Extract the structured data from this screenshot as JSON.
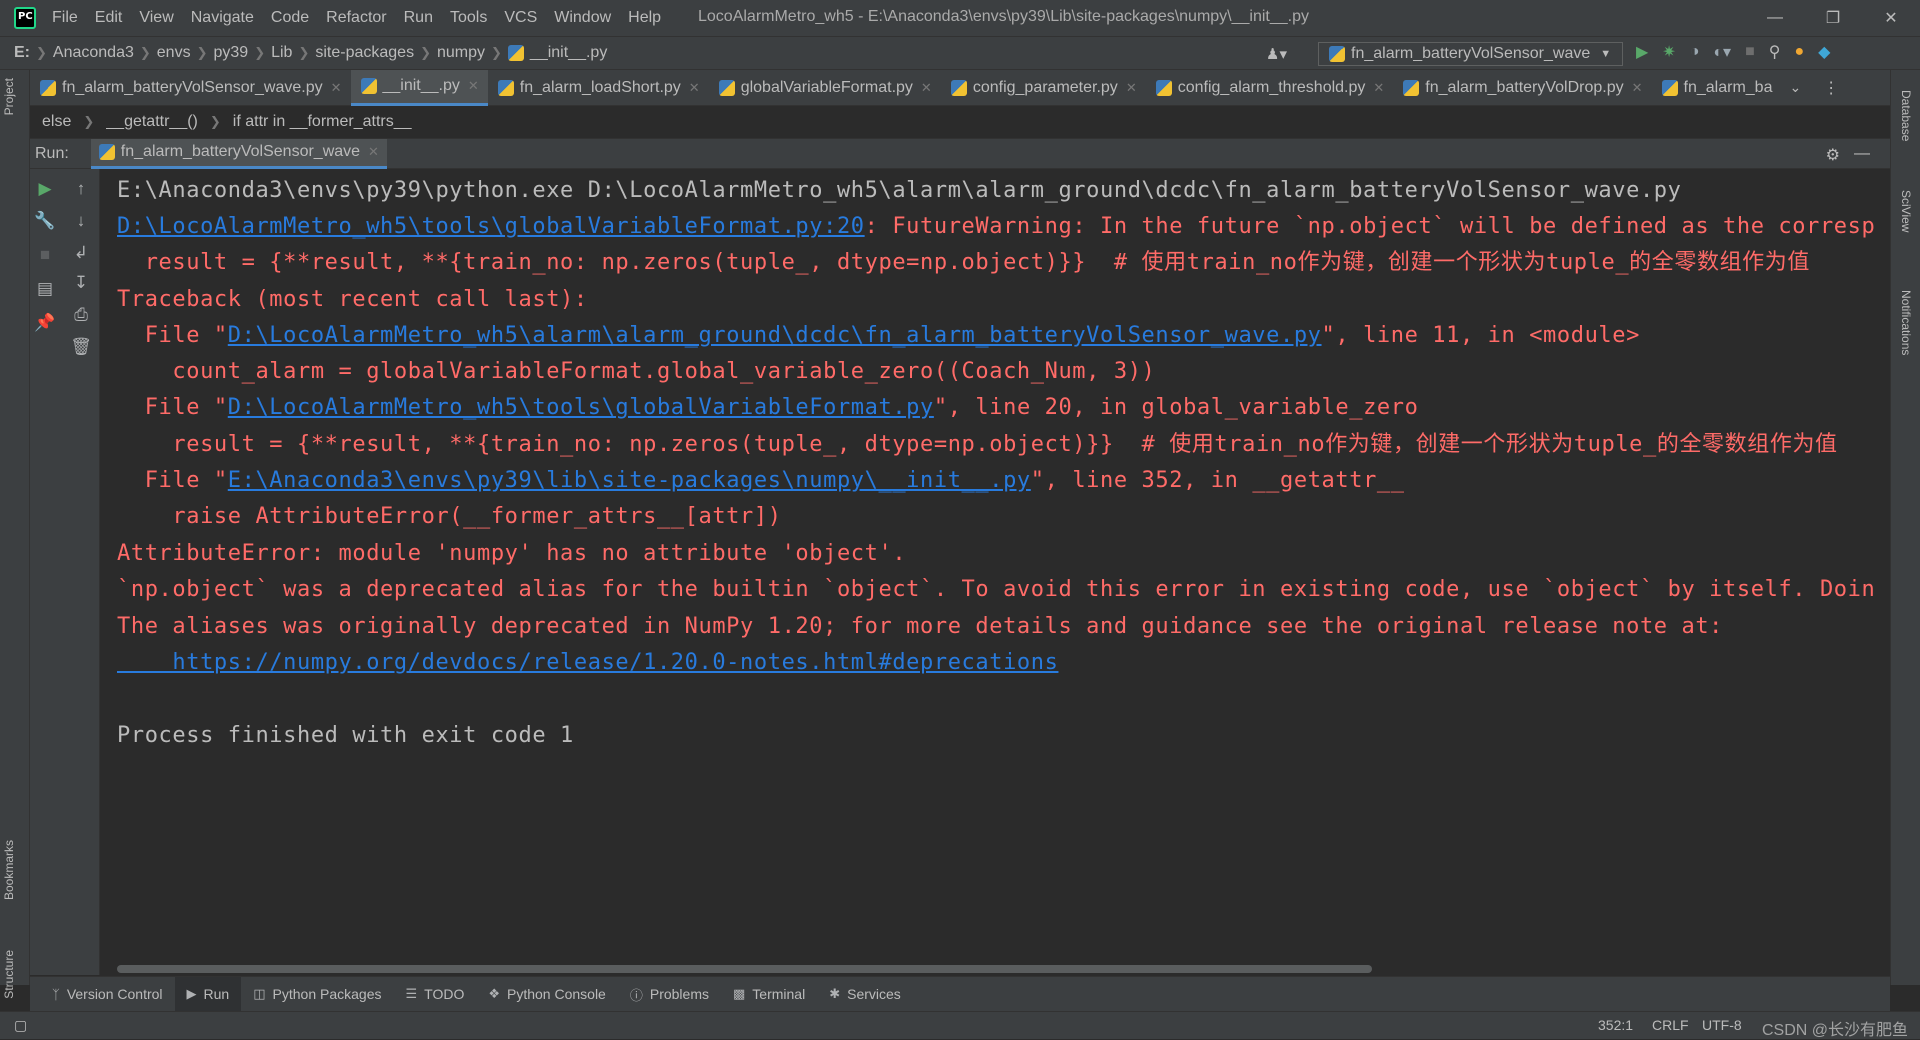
{
  "menu": [
    "File",
    "Edit",
    "View",
    "Navigate",
    "Code",
    "Refactor",
    "Run",
    "Tools",
    "VCS",
    "Window",
    "Help"
  ],
  "window_title": "LocoAlarmMetro_wh5 - E:\\Anaconda3\\envs\\py39\\Lib\\site-packages\\numpy\\__init__.py",
  "nav_crumbs": [
    "E:",
    "Anaconda3",
    "envs",
    "py39",
    "Lib",
    "site-packages",
    "numpy",
    "__init__.py"
  ],
  "run_config": "fn_alarm_batteryVolSensor_wave",
  "tabs": [
    {
      "label": "fn_alarm_batteryVolSensor_wave.py"
    },
    {
      "label": "__init__.py"
    },
    {
      "label": "fn_alarm_loadShort.py"
    },
    {
      "label": "globalVariableFormat.py"
    },
    {
      "label": "config_parameter.py"
    },
    {
      "label": "config_alarm_threshold.py"
    },
    {
      "label": "fn_alarm_batteryVolDrop.py"
    },
    {
      "label": "fn_alarm_ba"
    }
  ],
  "editor_breadcrumb": [
    "else",
    "__getattr__()",
    "if attr in __former_attrs__"
  ],
  "run_label": "Run:",
  "run_tab": "fn_alarm_batteryVolSensor_wave",
  "left_labels": {
    "project": "Project",
    "bookmarks": "Bookmarks",
    "structure": "Structure"
  },
  "right_labels": {
    "database": "Database",
    "sciview": "SciView",
    "notifications": "Notifications"
  },
  "console": {
    "l1": "E:\\Anaconda3\\envs\\py39\\python.exe D:\\LocoAlarmMetro_wh5\\alarm\\alarm_ground\\dcdc\\fn_alarm_batteryVolSensor_wave.py",
    "l2_link": "D:\\LocoAlarmMetro_wh5\\tools\\globalVariableFormat.py:20",
    "l2_rest": ": FutureWarning: In the future `np.object` will be defined as the corresp",
    "l3": "  result = {**result, **{train_no: np.zeros(tuple_, dtype=np.object)}}  # 使用train_no作为键，创建一个形状为tuple_的全零数组作为值",
    "l4": "Traceback (most recent call last):",
    "l5_pre": "  File \"",
    "l5_link": "D:\\LocoAlarmMetro_wh5\\alarm\\alarm_ground\\dcdc\\fn_alarm_batteryVolSensor_wave.py",
    "l5_post": "\", line 11, in <module>",
    "l6": "    count_alarm = globalVariableFormat.global_variable_zero((Coach_Num, 3))",
    "l7_pre": "  File \"",
    "l7_link": "D:\\LocoAlarmMetro_wh5\\tools\\globalVariableFormat.py",
    "l7_post": "\", line 20, in global_variable_zero",
    "l8": "    result = {**result, **{train_no: np.zeros(tuple_, dtype=np.object)}}  # 使用train_no作为键，创建一个形状为tuple_的全零数组作为值",
    "l9_pre": "  File \"",
    "l9_link": "E:\\Anaconda3\\envs\\py39\\lib\\site-packages\\numpy\\__init__.py",
    "l9_post": "\", line 352, in __getattr__",
    "l10": "    raise AttributeError(__former_attrs__[attr])",
    "l11": "AttributeError: module 'numpy' has no attribute 'object'.",
    "l12": "`np.object` was a deprecated alias for the builtin `object`. To avoid this error in existing code, use `object` by itself. Doin",
    "l13": "The aliases was originally deprecated in NumPy 1.20; for more details and guidance see the original release note at:",
    "l14_link": "    https://numpy.org/devdocs/release/1.20.0-notes.html#deprecations",
    "l16": "Process finished with exit code 1"
  },
  "tool_windows": [
    "Version Control",
    "Run",
    "Python Packages",
    "TODO",
    "Python Console",
    "Problems",
    "Terminal",
    "Services"
  ],
  "status": {
    "position": "352:1",
    "line_sep": "CRLF",
    "encoding": "UTF-8",
    "watermark": "CSDN @长沙有肥鱼"
  },
  "colors": {
    "error": "#ff6b68",
    "link": "#287bde",
    "bg": "#2b2b2b",
    "panel": "#3c3f41"
  }
}
